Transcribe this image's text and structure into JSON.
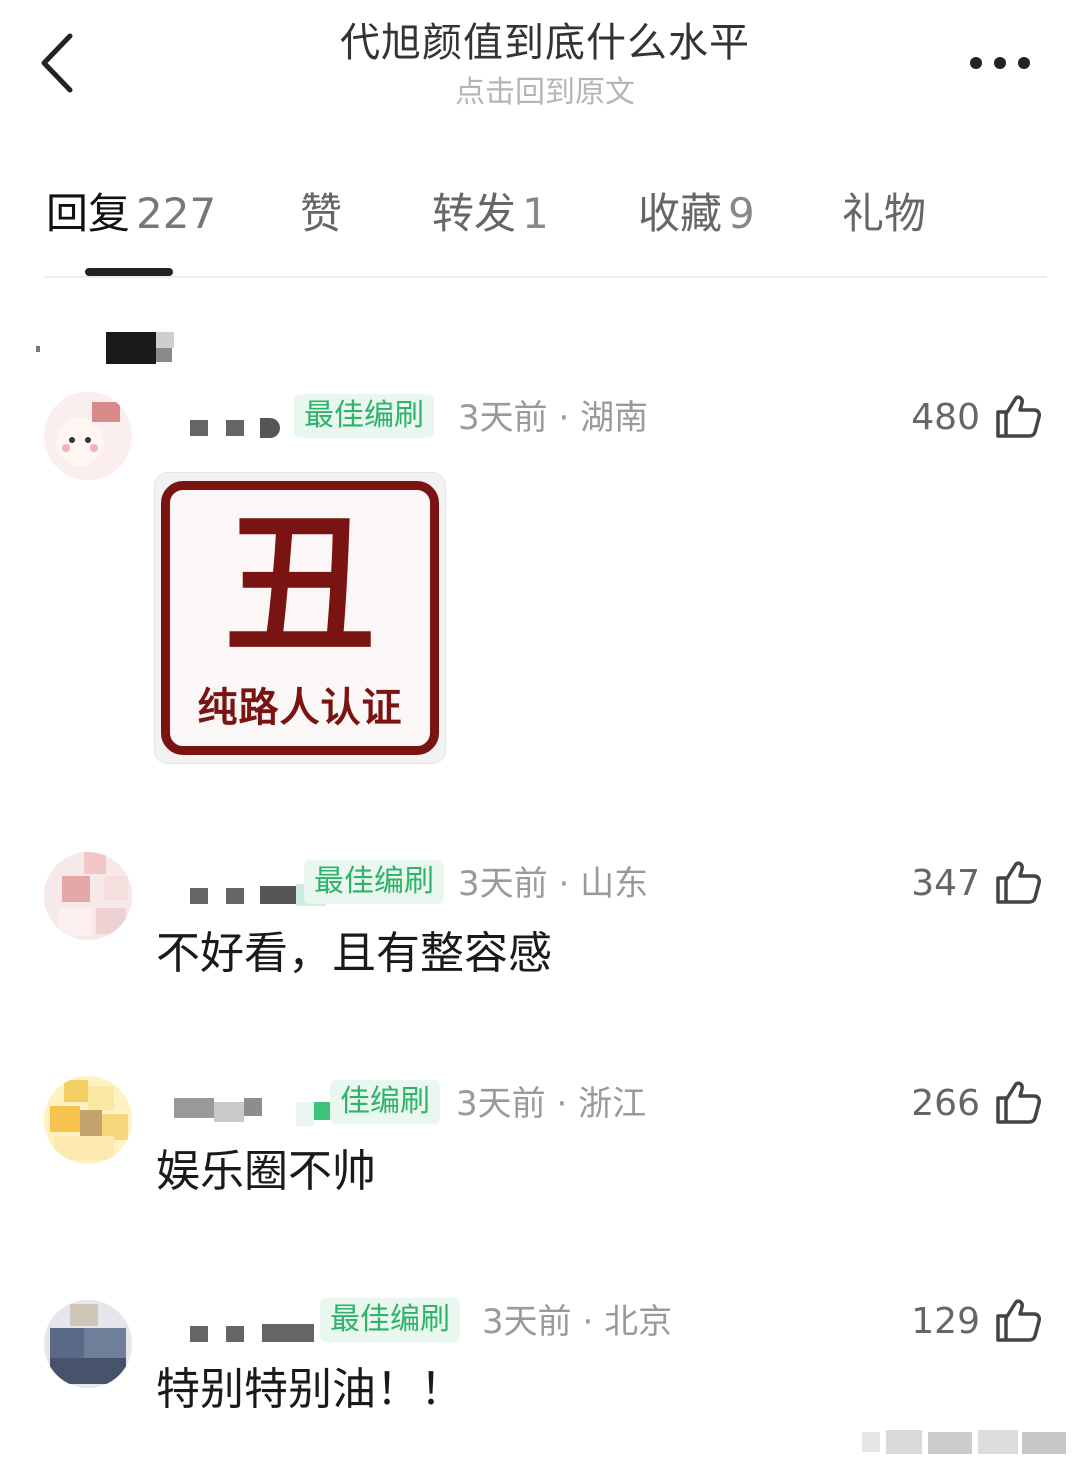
{
  "header": {
    "title": "代旭颜值到底什么水平",
    "subtitle": "点击回到原文"
  },
  "tabs": [
    {
      "label": "回复",
      "count": "227",
      "active": true
    },
    {
      "label": "赞",
      "count": "",
      "active": false
    },
    {
      "label": "转发",
      "count": "1",
      "active": false
    },
    {
      "label": "收藏",
      "count": "9",
      "active": false
    },
    {
      "label": "礼物",
      "count": "",
      "active": false
    }
  ],
  "comments": [
    {
      "badge": "最佳编刷",
      "time": "3天前",
      "location": "湖南",
      "likes": "480",
      "image": {
        "char": "丑",
        "caption": "纯路人认证"
      }
    },
    {
      "badge": "最佳编刷",
      "badge_visible": "最佳编刷",
      "time": "3天前",
      "location": "山东",
      "likes": "347",
      "text": "不好看，且有整容感"
    },
    {
      "badge": "佳编刷",
      "time": "3天前",
      "location": "浙江",
      "likes": "266",
      "text": "娱乐圈不帅"
    },
    {
      "badge": "最佳编刷",
      "time": "3天前",
      "location": "北京",
      "likes": "129",
      "text": "特别特别油！！"
    }
  ],
  "colors": {
    "badge_green": "#2fb36a",
    "badge_bg": "#e9f7ef",
    "stamp_red": "#7a1412"
  },
  "icons": [
    "back-arrow-icon",
    "more-dots-icon",
    "thumbs-up-icon"
  ]
}
